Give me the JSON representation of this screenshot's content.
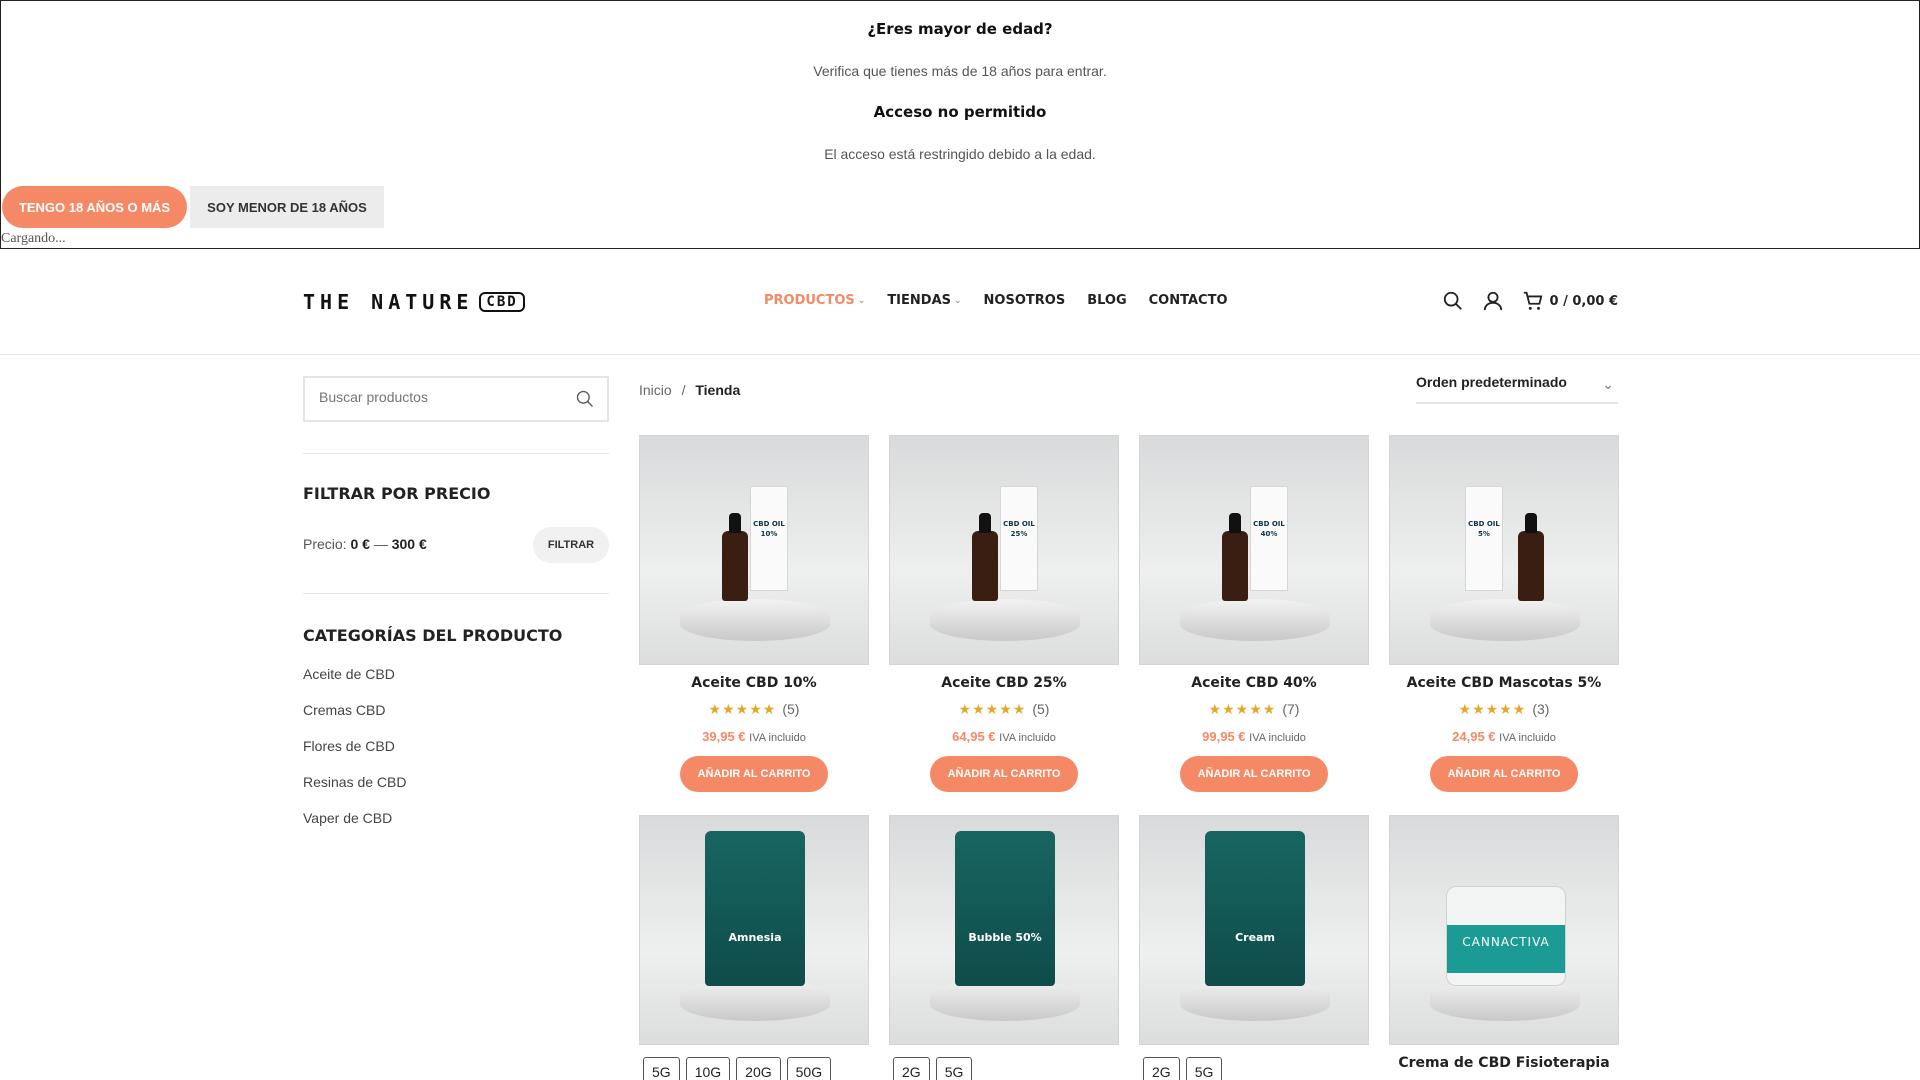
{
  "age_gate": {
    "title": "¿Eres mayor de edad?",
    "text": "Verifica que tienes más de 18 años para entrar.",
    "denied_title": "Acceso no permitido",
    "denied_text": "El acceso está restringido debido a la edad.",
    "yes_button": "TENGO 18 AÑOS O MÁS",
    "no_button": "SOY MENOR DE 18 AÑOS",
    "loading": "Cargando..."
  },
  "header": {
    "logo_text": "THE NATURE",
    "logo_badge": "CBD",
    "nav": [
      {
        "label": "PRODUCTOS",
        "dropdown": true,
        "active": true
      },
      {
        "label": "TIENDAS",
        "dropdown": true
      },
      {
        "label": "NOSOTROS"
      },
      {
        "label": "BLOG"
      },
      {
        "label": "CONTACTO"
      }
    ],
    "cart_summary": "0 / 0,00 €"
  },
  "sidebar": {
    "search_placeholder": "Buscar productos",
    "price_filter_title": "FILTRAR POR PRECIO",
    "price_label": "Precio:",
    "price_min": "0 €",
    "price_sep": "—",
    "price_max": "300 €",
    "filter_button": "FILTRAR",
    "categories_title": "CATEGORÍAS DEL PRODUCTO",
    "categories": [
      "Aceite de CBD",
      "Cremas CBD",
      "Flores de CBD",
      "Resinas de CBD",
      "Vaper de CBD"
    ]
  },
  "main": {
    "breadcrumb_home": "Inicio",
    "breadcrumb_sep": "/",
    "breadcrumb_current": "Tienda",
    "sort_label": "Orden predeterminado",
    "add_to_cart": "AÑADIR AL CARRITO",
    "tax_note": "IVA incluido",
    "products": [
      {
        "title": "Aceite CBD 10%",
        "stars": "★★★★★",
        "reviews": "(5)",
        "price": "39,95 €",
        "type": "oil",
        "label": "CBD OIL 10%"
      },
      {
        "title": "Aceite CBD 25%",
        "stars": "★★★★★",
        "reviews": "(5)",
        "price": "64,95 €",
        "type": "oil",
        "label": "CBD OIL 25%"
      },
      {
        "title": "Aceite CBD 40%",
        "stars": "★★★★★",
        "reviews": "(7)",
        "price": "99,95 €",
        "type": "oil",
        "label": "CBD OIL 40%"
      },
      {
        "title": "Aceite CBD Mascotas 5%",
        "stars": "★★★★★",
        "reviews": "(3)",
        "price": "24,95 €",
        "type": "oil",
        "label": "CBD OIL 5%"
      },
      {
        "type": "pouch",
        "label": "Amnesia",
        "sizes": [
          "5G",
          "10G",
          "20G",
          "50G"
        ]
      },
      {
        "type": "pouch",
        "label": "Bubble 50%",
        "sizes": [
          "2G",
          "5G"
        ]
      },
      {
        "type": "pouch",
        "label": "Cream",
        "sizes": [
          "2G",
          "5G"
        ]
      },
      {
        "type": "jar",
        "label": "CANNACTIVA",
        "title": "Crema de CBD Fisioterapia"
      }
    ]
  },
  "colors": {
    "accent": "#f58966",
    "star": "#e1a82a",
    "pouch": "#176561"
  }
}
